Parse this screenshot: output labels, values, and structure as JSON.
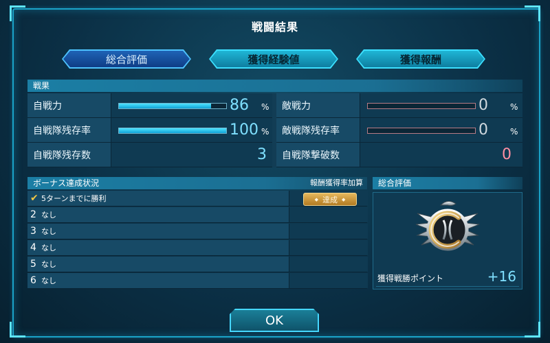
{
  "window": {
    "title": "戦闘結果"
  },
  "tabs": [
    {
      "label": "総合評価",
      "active": true
    },
    {
      "label": "獲得経験値",
      "active": false
    },
    {
      "label": "獲得報酬",
      "active": false
    }
  ],
  "results": {
    "header": "戦果",
    "own_power": {
      "label": "自戦力",
      "value": "86",
      "unit": "%",
      "fill": 0.86
    },
    "own_fleet_survival_rate": {
      "label": "自戦隊残存率",
      "value": "100",
      "unit": "%",
      "fill": 1.0
    },
    "own_fleet_survivors": {
      "label": "自戦隊残存数",
      "value": "3"
    },
    "enemy_power": {
      "label": "敵戦力",
      "value": "0",
      "unit": "%",
      "fill": 0.0
    },
    "enemy_fleet_survival_rate": {
      "label": "敵戦隊残存率",
      "value": "0",
      "unit": "%",
      "fill": 0.0
    },
    "enemy_fleets_destroyed": {
      "label": "自戦隊撃破数",
      "value": "0"
    }
  },
  "bonus": {
    "header": "ボーナス達成状況",
    "rate_header": "報酬獲得率加算",
    "rows": [
      {
        "num": "",
        "text": "5ターンまでに勝利",
        "status": "達成",
        "achieved": true
      },
      {
        "num": "2",
        "text": "なし",
        "status": ""
      },
      {
        "num": "3",
        "text": "なし",
        "status": ""
      },
      {
        "num": "4",
        "text": "なし",
        "status": ""
      },
      {
        "num": "5",
        "text": "なし",
        "status": ""
      },
      {
        "num": "6",
        "text": "なし",
        "status": ""
      }
    ]
  },
  "evaluation": {
    "header": "総合評価",
    "emblem_icon": "winged-c-rank-emblem-icon",
    "points_label": "獲得戦勝ポイント",
    "points_value": "+16"
  },
  "ok_button": {
    "label": "OK"
  },
  "colors": {
    "accent": "#1aa3c8",
    "value_blue": "#7fe0ff",
    "value_red": "#ff8fa3",
    "achieve_gold": "#d9a445"
  }
}
